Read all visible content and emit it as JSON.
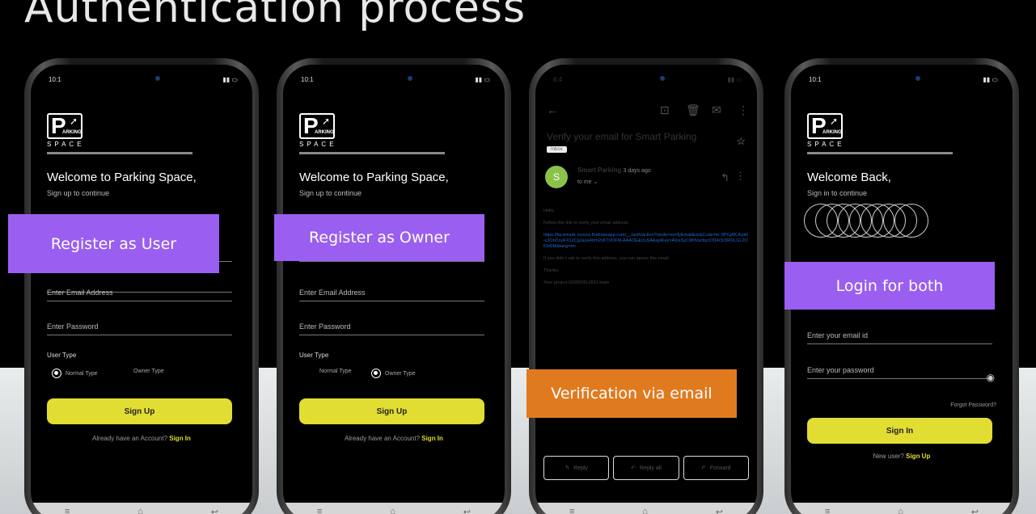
{
  "slide": {
    "title": "Authentication process"
  },
  "colors": {
    "accent_yellow": "#e2dd33",
    "label_purple": "#9a5ff0",
    "label_orange": "#e07a1f"
  },
  "phone1": {
    "time": "10:1",
    "logo_letter": "P",
    "logo_small": "ARKING",
    "logo_word": "SPACE",
    "welcome": "Welcome to Parking Space,",
    "subtitle": "Sign up to continue",
    "email_placeholder": "Enter Email Address",
    "password_placeholder": "Enter Password",
    "user_type_label": "User Type",
    "radio_normal": "Normal Type",
    "radio_owner": "Owner Type",
    "signup_button": "Sign Up",
    "already_text": "Already have an Account?",
    "signin_link": "Sign In"
  },
  "phone2": {
    "time": "10:1",
    "logo_letter": "P",
    "logo_small": "ARKING",
    "logo_word": "SPACE",
    "welcome": "Welcome to Parking Space,",
    "subtitle": "Sign up to continue",
    "email_placeholder": "Enter Email Address",
    "password_placeholder": "Enter Password",
    "user_type_label": "User Type",
    "radio_normal": "Normal Type",
    "radio_owner": "Owner Type",
    "signup_button": "Sign Up",
    "already_text": "Already have an Account?",
    "signin_link": "Sign In"
  },
  "phone3": {
    "time": "6:4",
    "subject": "Verify your email for Smart Parking",
    "inbox_tag": "Inbox",
    "avatar_letter": "S",
    "sender": "Smart Parking",
    "when": "3 days ago",
    "to": "to me",
    "body_hello": "Hello,",
    "body_follow": "Follow this link to verify your email address.",
    "body_link": "https://facemask-xxxxxx.firebaseapp.com/__/auth/action?mode=verifyEmail&oobCode=m-SPGjAKJkeiR-cJOnCnoFX1zCgJaza4zim2zKTrIOFM-AAAOE&UuSA&apiKey=AIzaSyC9fdVacbycOD4r3c9RDLGL2OlOrl0M&lang=en",
    "body_ignore": "If you didn`t ask to verify this address, you can ignore this email.",
    "body_thanks": "Thanks,",
    "body_team": "Your project-926853512651 team",
    "action_reply": "Reply",
    "action_reply_all": "Reply all",
    "action_forward": "Forward"
  },
  "phone4": {
    "time": "10:1",
    "logo_letter": "P",
    "logo_small": "ARKING",
    "logo_word": "SPACE",
    "welcome": "Welcome Back,",
    "subtitle": "Sign in to continue",
    "email_placeholder": "Enter your email id",
    "password_placeholder": "Enter your password",
    "forgot": "Forgot Password?",
    "signin_button": "Sign In",
    "new_user_text": "New user?",
    "signup_link": "Sign Up"
  },
  "labels": {
    "register_user": "Register as User",
    "register_owner": "Register as Owner",
    "verification": "Verification via email",
    "login_both": "Login for both"
  }
}
